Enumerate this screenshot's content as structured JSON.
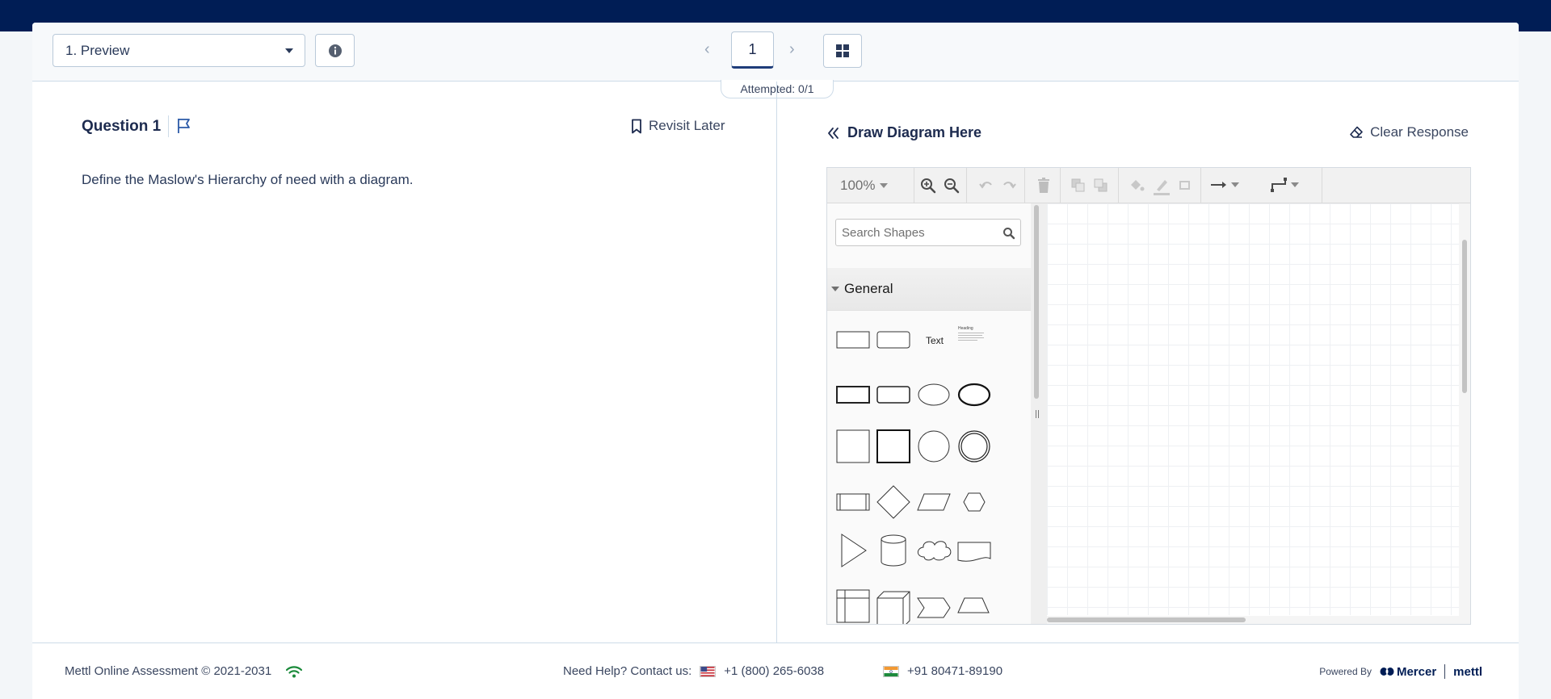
{
  "navbar": {
    "question_select": "1. Preview",
    "current_page": "1",
    "attempted": "Attempted: 0/1"
  },
  "question": {
    "title": "Question 1",
    "revisit_label": "Revisit Later",
    "text": "Define the Maslow's Hierarchy of need with a diagram."
  },
  "response": {
    "title": "Draw Diagram Here",
    "clear_label": "Clear Response"
  },
  "editor": {
    "zoom": "100%",
    "search_placeholder": "Search Shapes",
    "section": "General",
    "shape_text_label": "Text",
    "shape_heading_label": "Heading"
  },
  "footer": {
    "copyright": "Mettl Online Assessment © 2021-2031",
    "help_label": "Need Help? Contact us:",
    "phone_us": "+1 (800) 265-6038",
    "phone_in": "+91 80471-89190",
    "powered_by": "Powered By",
    "brand_mercer": "Mercer",
    "brand_mettl": "mettl"
  },
  "colors": {
    "topbar": "#001d55",
    "accent": "#1f3d7a",
    "wifi": "#1a8a3a"
  }
}
